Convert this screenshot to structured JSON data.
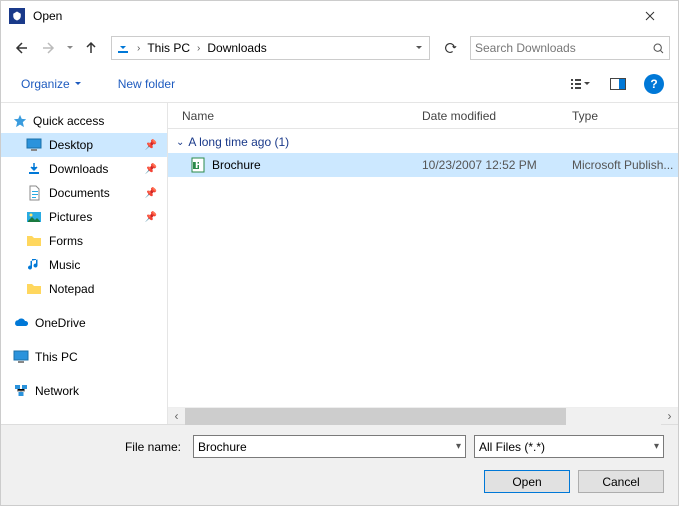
{
  "window": {
    "title": "Open"
  },
  "breadcrumb": {
    "segments": [
      "This PC",
      "Downloads"
    ]
  },
  "search": {
    "placeholder": "Search Downloads"
  },
  "toolbar": {
    "organize": "Organize",
    "newfolder": "New folder"
  },
  "sidebar": {
    "quick": {
      "label": "Quick access",
      "items": [
        {
          "label": "Desktop",
          "pinned": true,
          "selected": true,
          "icon": "desktop"
        },
        {
          "label": "Downloads",
          "pinned": true,
          "icon": "downloads"
        },
        {
          "label": "Documents",
          "pinned": true,
          "icon": "documents"
        },
        {
          "label": "Pictures",
          "pinned": true,
          "icon": "pictures"
        },
        {
          "label": "Forms",
          "icon": "folder"
        },
        {
          "label": "Music",
          "icon": "music"
        },
        {
          "label": "Notepad",
          "icon": "folder"
        }
      ]
    },
    "onedrive": {
      "label": "OneDrive"
    },
    "thispc": {
      "label": "This PC"
    },
    "network": {
      "label": "Network"
    }
  },
  "columns": {
    "name": "Name",
    "date": "Date modified",
    "type": "Type"
  },
  "group": {
    "label": "A long time ago (1)"
  },
  "files": [
    {
      "name": "Brochure",
      "date": "10/23/2007 12:52 PM",
      "type": "Microsoft Publish...",
      "selected": true
    }
  ],
  "footer": {
    "filename_label": "File name:",
    "filename_value": "Brochure",
    "filter_value": "All Files (*.*)",
    "open": "Open",
    "cancel": "Cancel"
  }
}
